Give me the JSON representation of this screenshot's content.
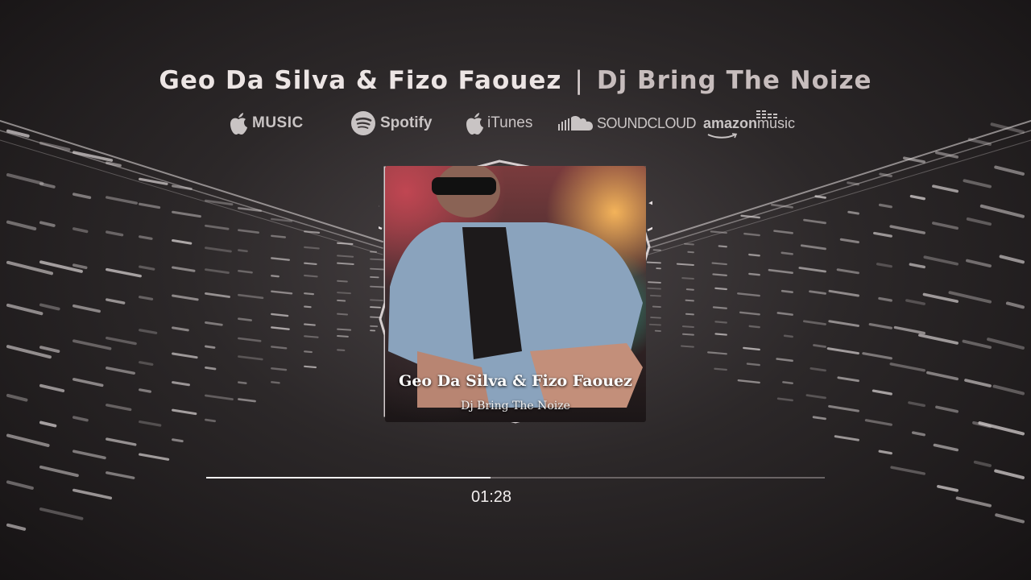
{
  "header": {
    "artist": "Geo Da Silva & Fizo Faouez",
    "separator": "|",
    "song": "Dj Bring The Noize"
  },
  "platforms": [
    {
      "name": "apple-music",
      "icon": "apple-icon",
      "label": "MUSIC"
    },
    {
      "name": "spotify",
      "icon": "spotify-icon",
      "label": "Spotify"
    },
    {
      "name": "itunes",
      "icon": "apple-icon",
      "label": "iTunes"
    },
    {
      "name": "soundcloud",
      "icon": "soundcloud-icon",
      "label": "SOUNDCLOUD"
    },
    {
      "name": "amazon-music",
      "icon": "amazon-icon",
      "label_bold": "amazon",
      "label_light": "music"
    }
  ],
  "cover": {
    "title": "Geo Da Silva & Fizo Faouez",
    "subtitle": "Dj Bring The Noize"
  },
  "player": {
    "elapsed": "01:28",
    "progress_fraction": 0.46
  },
  "colors": {
    "background": "#2c2829",
    "accent": "#f4f1f1",
    "track": "#6a6465"
  }
}
